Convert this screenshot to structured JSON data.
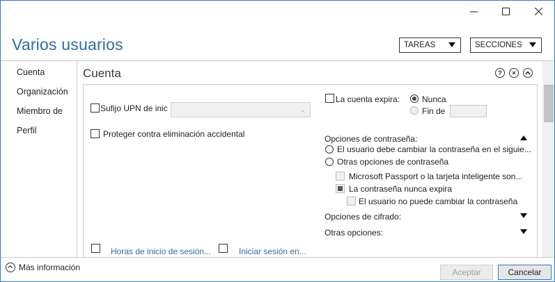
{
  "window": {
    "minimize_label": "minimize",
    "maximize_label": "maximize",
    "close_label": "close"
  },
  "header": {
    "title": "Varios usuarios",
    "tasks_label": "TAREAS",
    "sections_label": "SECCIONES"
  },
  "nav": {
    "items": [
      {
        "label": "Cuenta"
      },
      {
        "label": "Organización"
      },
      {
        "label": "Miembro de"
      },
      {
        "label": "Perfil"
      }
    ]
  },
  "section": {
    "title": "Cuenta",
    "help_glyph": "?",
    "close_glyph": "×"
  },
  "account": {
    "upn_label": "Sufijo UPN de inic",
    "upn_value": "",
    "protect_label": "Proteger contra eliminación accidental",
    "expires_label": "La cuenta expira:",
    "never_label": "Nunca",
    "end_label": "Fin de",
    "end_value": "",
    "password_options_label": "Opciones de contraseña:",
    "must_change_label": "El usuario debe cambiar la contraseña en el siguie...",
    "other_password_options_label": "Otras opciones de contraseña",
    "passport_label": "Microsoft Passport o la tarjeta inteligente son...",
    "never_expires_label": "La contraseña nunca expira",
    "cannot_change_label": "El usuario no puede cambiar la contraseña",
    "encryption_options_label": "Opciones de cifrado:",
    "other_options_label": "Otras opciones:",
    "logon_hours_label": "Horas de inicio de sesión...",
    "logon_to_label": "Iniciar sesión en..."
  },
  "footer": {
    "more_info_label": "Más información",
    "accept_label": "Aceptar",
    "cancel_label": "Cancelar"
  },
  "colors": {
    "accent": "#2a6ea6",
    "window_border": "#2b7bcf"
  }
}
